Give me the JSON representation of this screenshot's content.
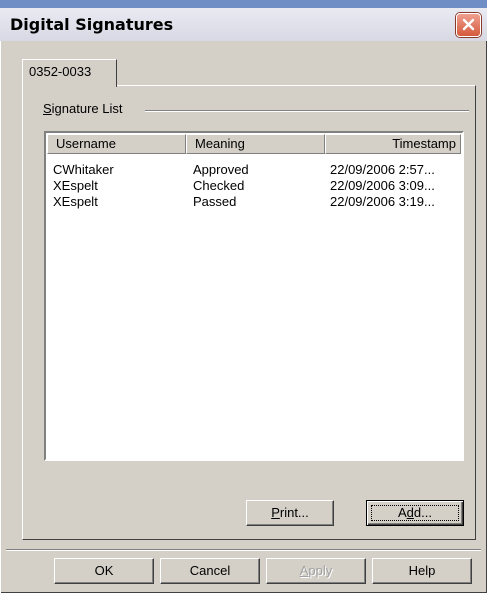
{
  "window": {
    "title": "Digital Signatures"
  },
  "tab": {
    "label": "0352-0033"
  },
  "group": {
    "label_prefix": "",
    "label_mnemonic": "S",
    "label_rest": "ignature List"
  },
  "list": {
    "columns": [
      "Username",
      "Meaning",
      "Timestamp"
    ],
    "rows": [
      [
        "CWhitaker",
        "Approved",
        "22/09/2006 2:57..."
      ],
      [
        "XEspelt",
        "Checked",
        "22/09/2006 3:09..."
      ],
      [
        "XEspelt",
        "Passed",
        "22/09/2006 3:19..."
      ]
    ]
  },
  "buttons": {
    "print_mnemonic": "P",
    "print_rest": "rint...",
    "add_prefix": "A",
    "add_mnemonic": "d",
    "add_rest": "d...",
    "ok": "OK",
    "cancel": "Cancel",
    "apply_mnemonic": "A",
    "apply_rest": "pply",
    "help": "Help"
  },
  "icons": {
    "close": "close-icon"
  },
  "colors": {
    "desktop": "#6f8ec6",
    "dialog": "#d4d0c8",
    "close_button": "#d45a3c"
  }
}
